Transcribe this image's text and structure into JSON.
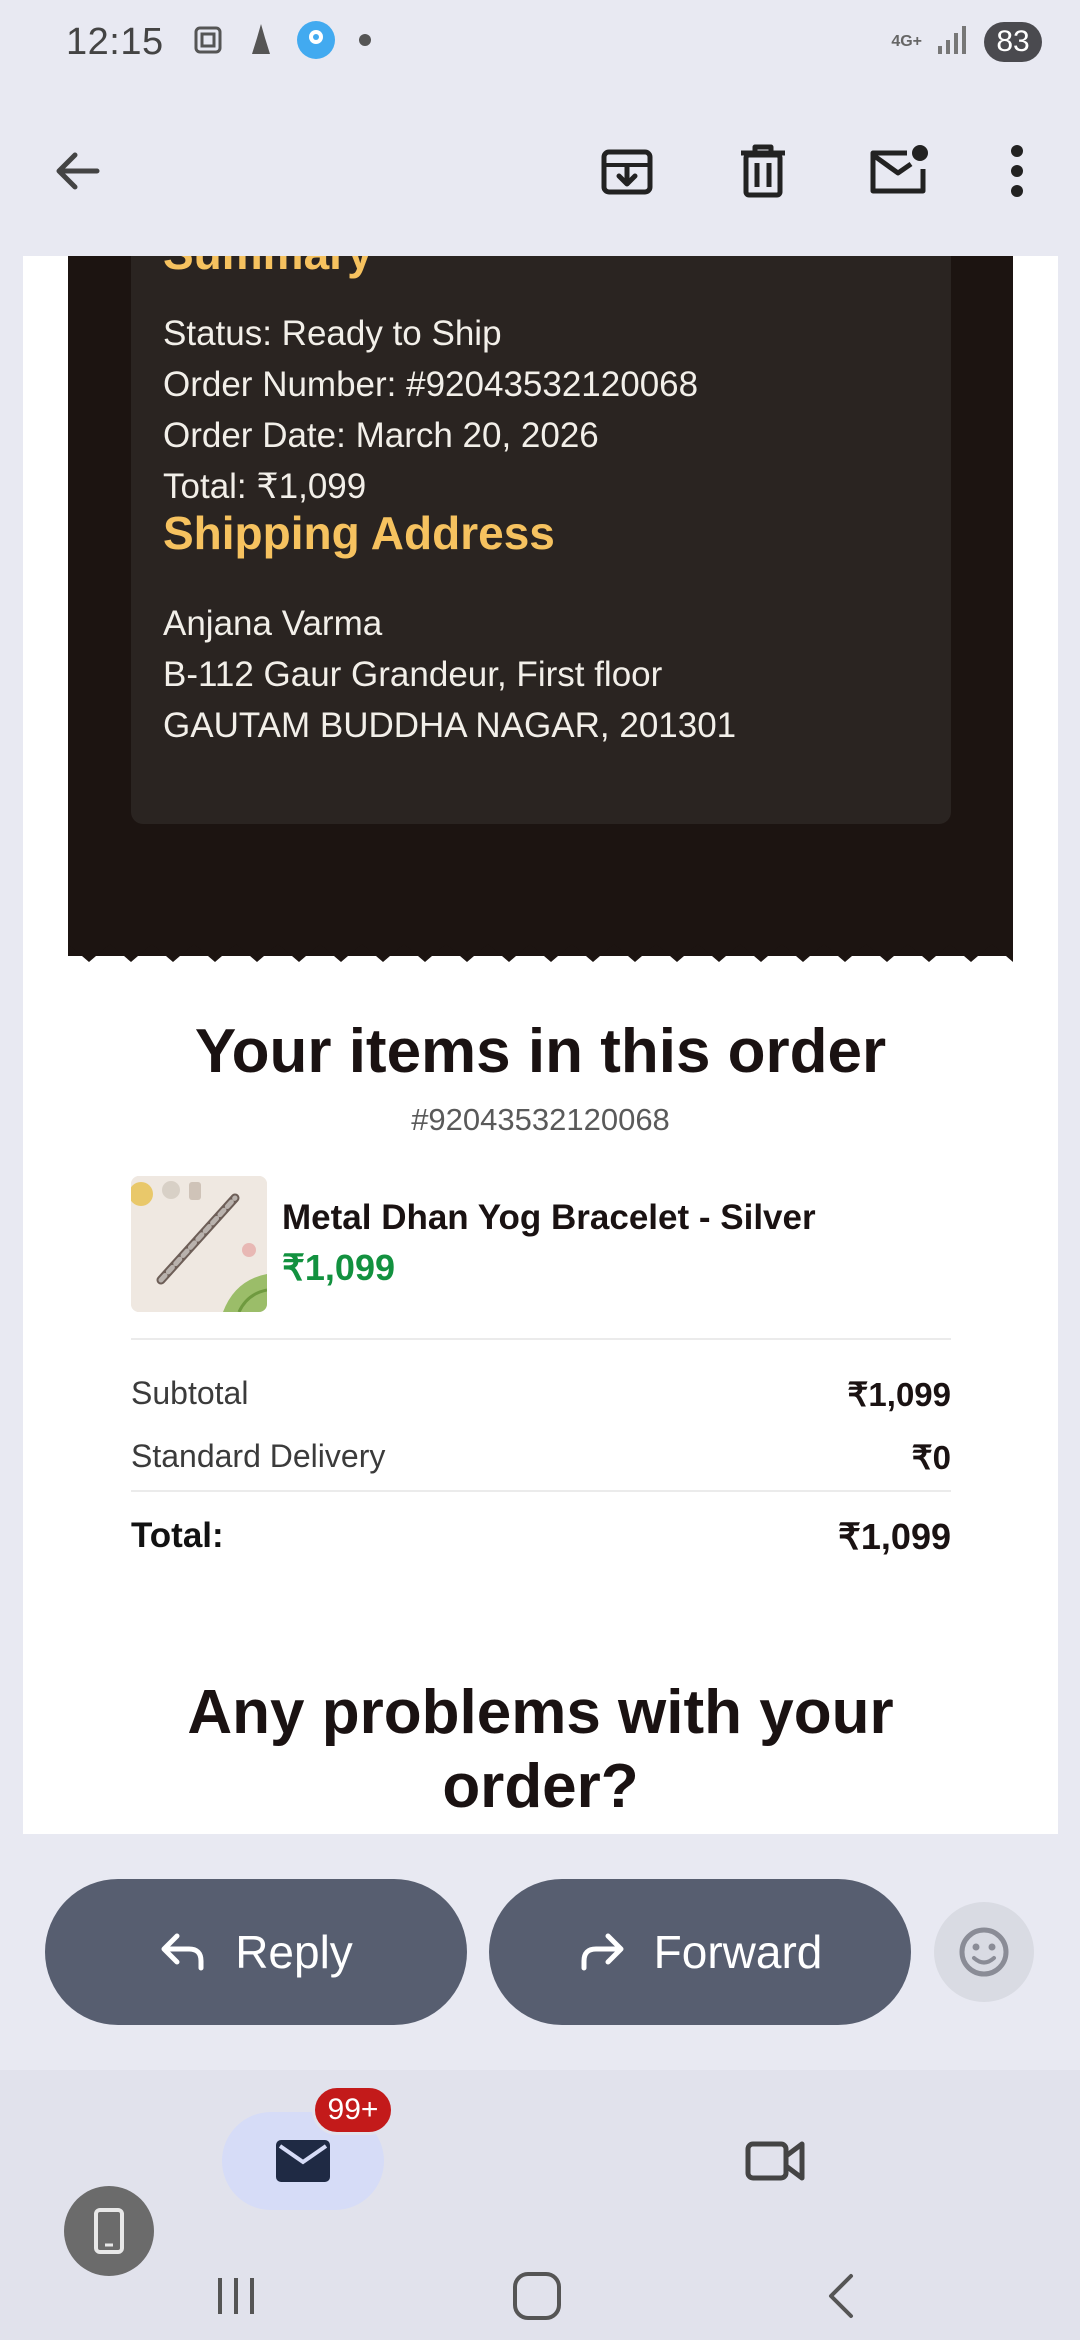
{
  "status_bar": {
    "time": "12:15",
    "network": "4G+",
    "battery": "83"
  },
  "toolbar": {
    "icons": [
      "back-arrow-icon",
      "archive-icon",
      "delete-icon",
      "mark-unread-icon",
      "more-vert-icon"
    ]
  },
  "email": {
    "summary": {
      "heading": "Summary",
      "status": "Status: Ready to Ship",
      "order_number": "Order Number: #92043532120068",
      "order_date": "Order Date: March 20, 2026",
      "total": "Total: ₹1,099"
    },
    "shipping": {
      "heading": "Shipping Address",
      "name": "Anjana Varma",
      "line1": "B-112 Gaur Grandeur, First floor",
      "line2": "GAUTAM BUDDHA NAGAR, 201301"
    },
    "items_title": "Your items in this order",
    "items_order_number": "#92043532120068",
    "product": {
      "name": "Metal Dhan Yog Bracelet - Silver",
      "price": "₹1,099"
    },
    "subtotal_label": "Subtotal",
    "subtotal_value": "₹1,099",
    "delivery_label": "Standard Delivery",
    "delivery_value": "₹0",
    "total_label": "Total:",
    "total_value": "₹1,099",
    "problems_line1": "Any problems with your",
    "problems_line2": "order?"
  },
  "actions": {
    "reply_label": "Reply",
    "forward_label": "Forward"
  },
  "bottom_nav": {
    "mail_badge": "99+"
  },
  "colors": {
    "accent_gold": "#f6c25f",
    "dark_bg": "#1c1411",
    "price_green": "#12913f",
    "pill_bg": "#575e70",
    "badge_red": "#c31a1a"
  }
}
